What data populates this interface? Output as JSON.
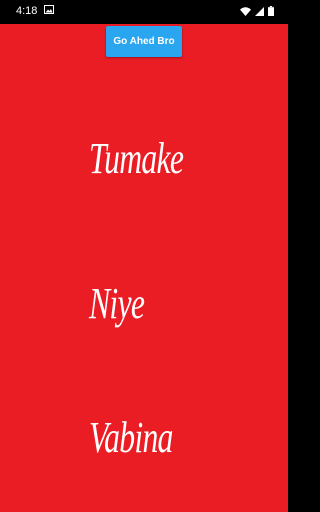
{
  "status_bar": {
    "time": "4:18",
    "icons": [
      "image-icon",
      "wifi-icon",
      "signal-icon",
      "battery-icon"
    ]
  },
  "go_button": {
    "label": "Go Ahed Bro"
  },
  "words": [
    "Tumake",
    "Niye",
    "Vabina"
  ],
  "colors": {
    "background": "#ea1d25",
    "button": "#2aa6f0",
    "text": "#ffffff",
    "status_bar": "#000000"
  }
}
